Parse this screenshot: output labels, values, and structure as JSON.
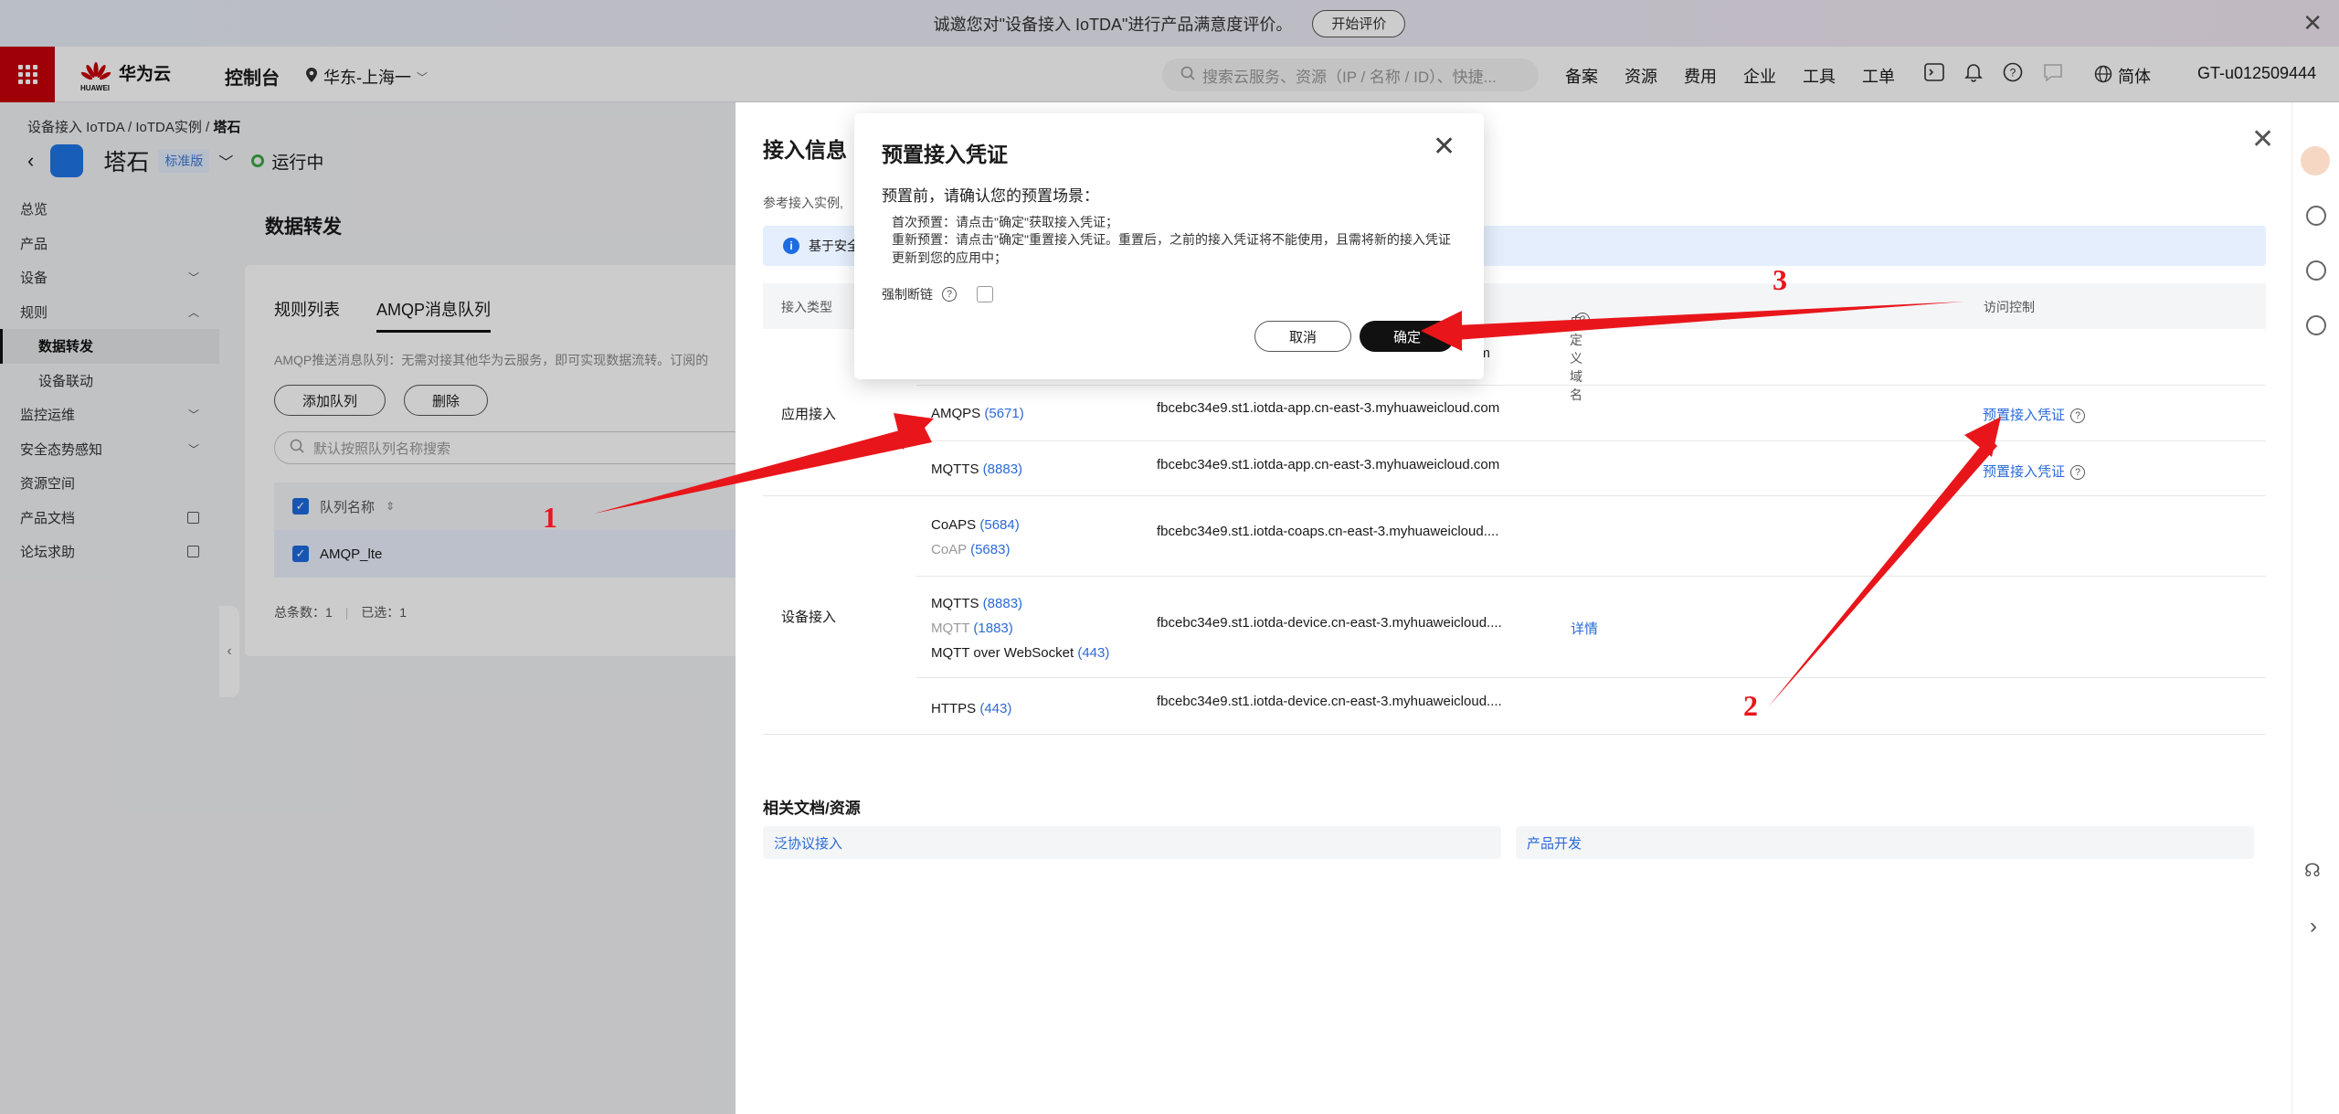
{
  "banner": {
    "text": "诚邀您对\"设备接入 IoTDA\"进行产品满意度评价。",
    "button": "开始评价"
  },
  "topnav": {
    "logo_text": "华为云",
    "logo_sub": "HUAWEI",
    "console": "控制台",
    "region": "华东-上海一",
    "search_placeholder": "搜索云服务、资源（IP / 名称 / ID）、快捷...",
    "links": [
      "备案",
      "资源",
      "费用",
      "企业",
      "工具",
      "工单"
    ],
    "lang": "简体",
    "user": "GT-u012509444"
  },
  "breadcrumb": {
    "a": "设备接入 IoTDA",
    "b": "IoTDA实例",
    "c": "塔石"
  },
  "instance": {
    "name": "塔石",
    "edition": "标准版",
    "status": "运行中"
  },
  "sidebar": {
    "items": [
      {
        "label": "总览"
      },
      {
        "label": "产品"
      },
      {
        "label": "设备"
      },
      {
        "label": "规则"
      },
      {
        "label": "数据转发"
      },
      {
        "label": "设备联动"
      },
      {
        "label": "监控运维"
      },
      {
        "label": "安全态势感知"
      },
      {
        "label": "资源空间"
      },
      {
        "label": "产品文档"
      },
      {
        "label": "论坛求助"
      }
    ]
  },
  "main": {
    "title": "数据转发",
    "tabs": [
      "规则列表",
      "AMQP消息队列"
    ],
    "desc": "AMQP推送消息队列：无需对接其他华为云服务，即可实现数据流转。订阅的",
    "add_button": "添加队列",
    "delete_button": "删除",
    "search_placeholder": "默认按照队列名称搜索",
    "col_name": "队列名称",
    "row_name": "AMQP_lte",
    "total": "总条数：1",
    "selected": "已选：1"
  },
  "drawer": {
    "title": "接入信息",
    "ref": "参考接入实例,",
    "info": "基于安全",
    "headers": {
      "type": "接入类型",
      "domain": "自定义域名",
      "access": "访问控制"
    },
    "row0_tail": "om",
    "app_access": "应用接入",
    "device_access": "设备接入",
    "rows": {
      "amqps": {
        "proto": "AMQPS",
        "port": "(5671)",
        "host": "fbcebc34e9.st1.iotda-app.cn-east-3.myhuaweicloud.com",
        "action": "预置接入凭证"
      },
      "mqtts_app": {
        "proto": "MQTTS",
        "port": "(8883)",
        "host": "fbcebc34e9.st1.iotda-app.cn-east-3.myhuaweicloud.com",
        "action": "预置接入凭证"
      },
      "coaps": {
        "proto": "CoAPS",
        "port": "(5684)",
        "proto2": "CoAP",
        "port2": "(5683)",
        "host": "fbcebc34e9.st1.iotda-coaps.cn-east-3.myhuaweicloud...."
      },
      "mqtts_dev": {
        "proto": "MQTTS",
        "port": "(8883)",
        "proto2": "MQTT",
        "port2": "(1883)",
        "proto3": "MQTT over WebSocket",
        "port3": "(443)",
        "host": "fbcebc34e9.st1.iotda-device.cn-east-3.myhuaweicloud....",
        "detail": "详情"
      },
      "https": {
        "proto": "HTTPS",
        "port": "(443)",
        "host": "fbcebc34e9.st1.iotda-device.cn-east-3.myhuaweicloud...."
      }
    },
    "docs_title": "相关文档/资源",
    "docs": [
      "泛协议接入",
      "产品开发"
    ]
  },
  "modal": {
    "title": "预置接入凭证",
    "question": "预置前，请确认您的预置场景：",
    "line1": "首次预置：请点击\"确定\"获取接入凭证；",
    "line2": "重新预置：请点击\"确定\"重置接入凭证。重置后，之前的接入凭证将不能使用，且需将新的接入凭证更新到您的应用中；",
    "force": "强制断链",
    "cancel": "取消",
    "ok": "确定"
  },
  "annotations": {
    "n1": "1",
    "n2": "2",
    "n3": "3",
    "color": "#e8161b"
  }
}
